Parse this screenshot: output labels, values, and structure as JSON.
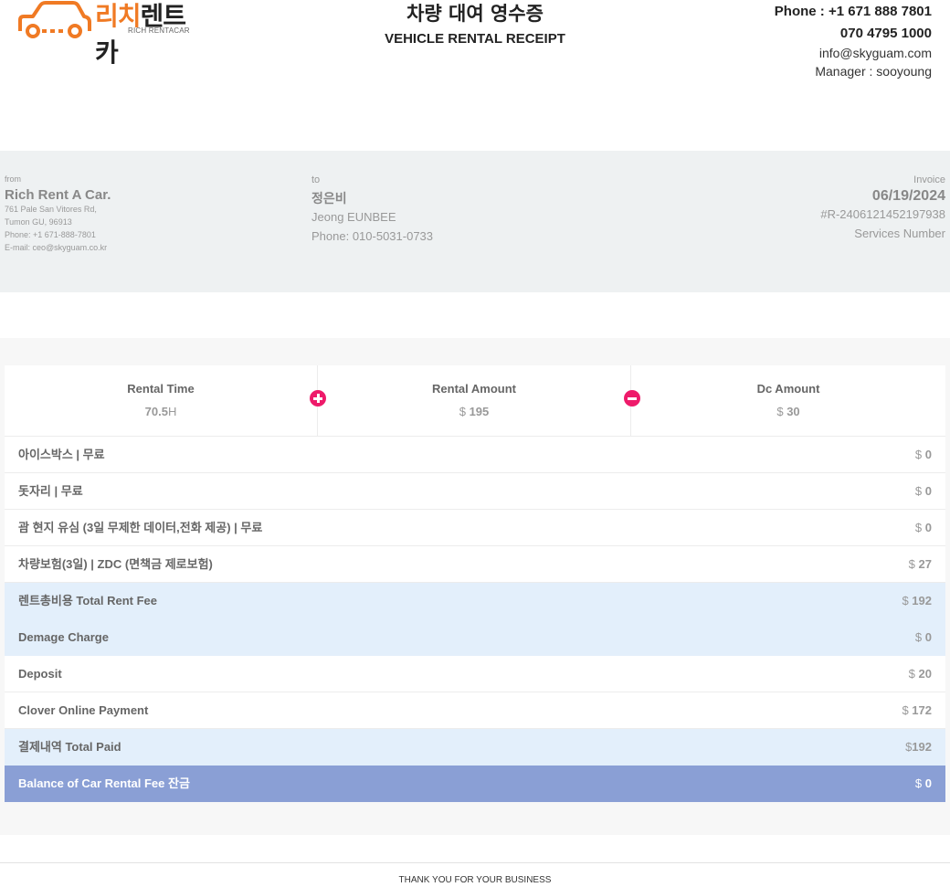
{
  "header": {
    "logo_kr_part1": "리치",
    "logo_kr_part2": "렌트카",
    "logo_en": "RICH RENTACAR",
    "title_kr": "차량 대여 영수증",
    "title_en": "VEHICLE RENTAL RECEIPT",
    "phone1": "Phone : +1 671 888 7801",
    "phone2": "070 4795 1000",
    "email": "info@skyguam.com",
    "manager": "Manager : sooyoung"
  },
  "from": {
    "label": "from",
    "name": "Rich Rent A Car.",
    "address1": "761 Pale San Vitores Rd,",
    "address2": "Tumon GU, 96913",
    "phone": "Phone: +1 671-888-7801",
    "email": "E-mail: ceo@skyguam.co.kr"
  },
  "to": {
    "label": "to",
    "name_kr": "정은비",
    "name_en": "Jeong EUNBEE",
    "phone": "Phone: 010-5031-0733"
  },
  "invoice": {
    "label": "Invoice",
    "date": "06/19/2024",
    "number": "#R-2406121452197938",
    "services": "Services Number"
  },
  "summary": {
    "rental_time_label": "Rental Time",
    "rental_time_value": "70.5",
    "rental_time_unit": "H",
    "rental_amount_label": "Rental Amount",
    "rental_amount_currency": "$",
    "rental_amount_value": "195",
    "dc_amount_label": "Dc Amount",
    "dc_amount_currency": "$",
    "dc_amount_value": "30"
  },
  "rows": [
    {
      "label": "아이스박스 | 무료",
      "currency": "$",
      "amount": "0"
    },
    {
      "label": "돗자리 | 무료",
      "currency": "$",
      "amount": "0"
    },
    {
      "label": "괌 현지 유심 (3일 무제한 데이터,전화 제공) | 무료",
      "currency": "$",
      "amount": "0"
    },
    {
      "label": "차량보험(3일) | ZDC (면책금 제로보험)",
      "currency": "$",
      "amount": "27"
    },
    {
      "label": "렌트총비용 Total Rent Fee",
      "currency": "$",
      "amount": "192"
    },
    {
      "label": "Demage Charge",
      "currency": "$",
      "amount": "0"
    },
    {
      "label": "Deposit",
      "currency": "$",
      "amount": "20"
    },
    {
      "label": "Clover Online Payment",
      "currency": "$",
      "amount": "172"
    },
    {
      "label": "결제내역 Total Paid",
      "currency": "$",
      "amount": "192"
    },
    {
      "label": "Balance of Car Rental Fee 잔금",
      "currency": "$",
      "amount": "0"
    }
  ],
  "footer": {
    "text": "THANK YOU FOR YOUR BUSINESS"
  },
  "colors": {
    "brand_orange": "#f07a24",
    "accent_pink": "#ee1a6a",
    "row_highlight": "#e3effb",
    "row_balance": "#8a9fd5"
  }
}
